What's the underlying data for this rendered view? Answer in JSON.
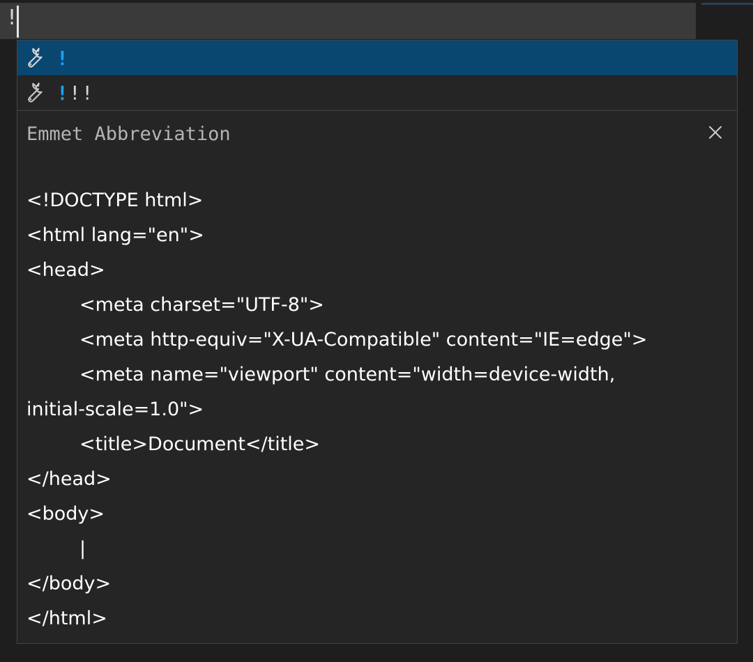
{
  "editor": {
    "typed_text": "!"
  },
  "suggestions": [
    {
      "match": "!",
      "rest": "",
      "icon": "wrench-icon",
      "selected": true
    },
    {
      "match": "!",
      "rest": "!!",
      "icon": "wrench-icon",
      "selected": false
    }
  ],
  "details": {
    "title": "Emmet Abbreviation",
    "close_icon": "close-icon",
    "code_lines": [
      "<!DOCTYPE html>",
      "<html lang=\"en\">",
      "<head>",
      "<meta charset=\"UTF-8\">",
      "<meta http-equiv=\"X-UA-Compatible\" content=\"IE=edge\">",
      "<meta name=\"viewport\" content=\"width=device-width,",
      "initial-scale=1.0\">",
      "<title>Document</title>",
      "</head>",
      "<body>",
      "|",
      "</body>",
      "</html>"
    ]
  },
  "colors": {
    "background": "#1e1e1e",
    "selection": "#094771",
    "match_highlight": "#18a3ff",
    "widget_background": "#252526"
  }
}
